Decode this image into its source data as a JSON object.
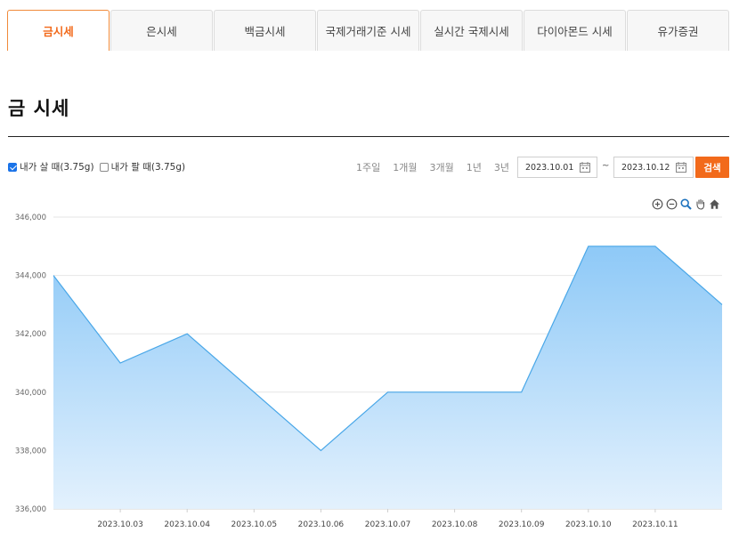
{
  "tabs": [
    "금시세",
    "은시세",
    "백금시세",
    "국제거래기준 시세",
    "실시간 국제시세",
    "다이아몬드 시세",
    "유가증권"
  ],
  "active_tab": 0,
  "page_title": "금 시세",
  "filters": {
    "buy_label": "내가 살 때(3.75g)",
    "buy_checked": true,
    "sell_label": "내가 팔 때(3.75g)",
    "sell_checked": false
  },
  "periods": [
    "1주일",
    "1개월",
    "3개월",
    "1년",
    "3년"
  ],
  "date_range": {
    "start": "2023.10.01",
    "separator": "~",
    "end": "2023.10.12"
  },
  "search_label": "검색",
  "chart_tools": [
    "zoom-in-icon",
    "zoom-out-icon",
    "magnify-icon",
    "pan-hand-icon",
    "home-icon"
  ],
  "colors": {
    "accent": "#f26a1b",
    "series_line": "#49a7e8",
    "series_fill_top": "#8ec9f7",
    "series_fill_bottom": "#e3f1fd"
  },
  "chart_data": {
    "type": "area",
    "title": "",
    "xlabel": "",
    "ylabel": "",
    "x_ticks": [
      "2023.10.03",
      "2023.10.04",
      "2023.10.05",
      "2023.10.06",
      "2023.10.07",
      "2023.10.08",
      "2023.10.09",
      "2023.10.10",
      "2023.10.11"
    ],
    "y_ticks": [
      336000,
      338000,
      340000,
      342000,
      344000,
      346000
    ],
    "y_tick_labels": [
      "336,000",
      "338,000",
      "340,000",
      "342,000",
      "344,000",
      "346,000"
    ],
    "ylim": [
      336000,
      346000
    ],
    "xlim": [
      "2023.10.02",
      "2023.10.12"
    ],
    "grid": true,
    "series": [
      {
        "x": [
          "2023.10.02",
          "2023.10.03",
          "2023.10.04",
          "2023.10.06",
          "2023.10.07",
          "2023.10.09",
          "2023.10.10",
          "2023.10.11",
          "2023.10.12"
        ],
        "y": [
          344000,
          341000,
          342000,
          338000,
          340000,
          340000,
          345000,
          345000,
          343000
        ]
      }
    ]
  }
}
